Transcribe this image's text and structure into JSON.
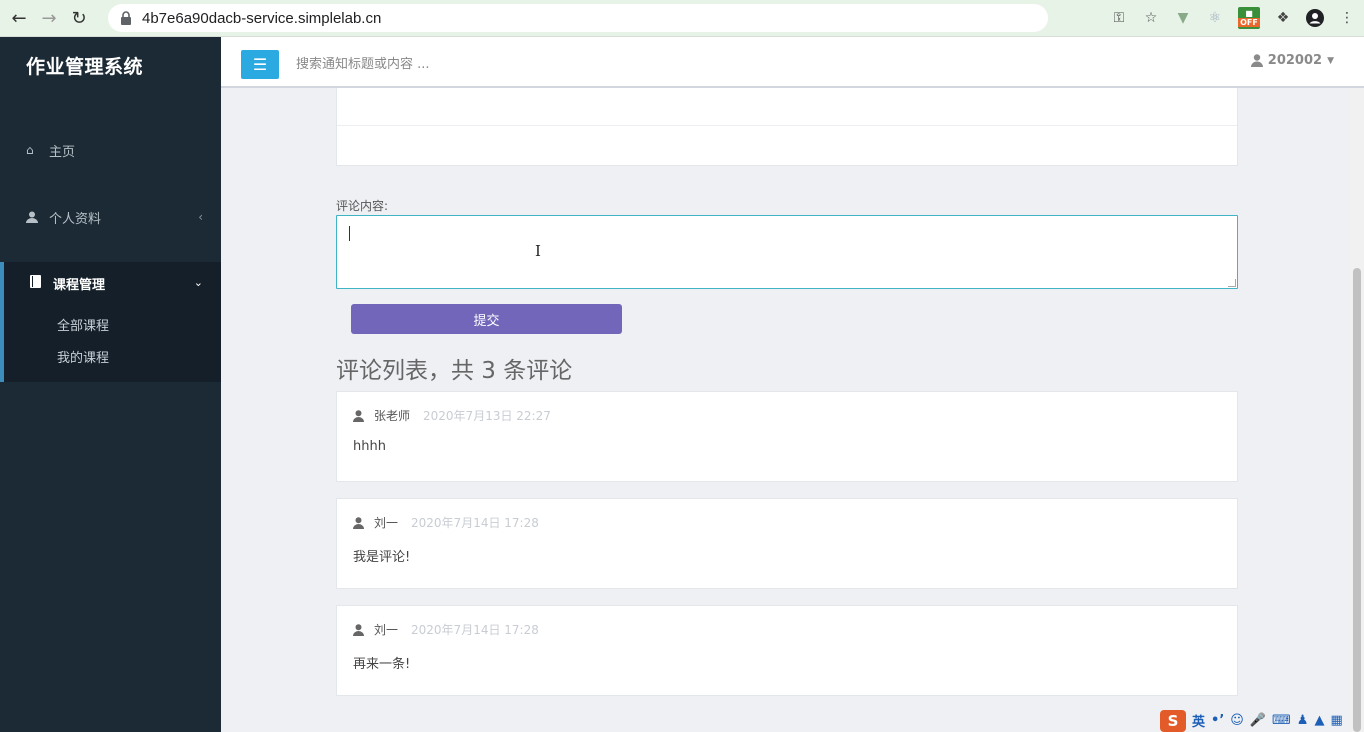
{
  "browser": {
    "url": "4b7e6a90dacb-service.simplelab.cn",
    "ext_off_label": "OFF"
  },
  "sidebar": {
    "brand": "作业管理系统",
    "items": [
      {
        "label": "主页"
      },
      {
        "label": "个人资料"
      },
      {
        "label": "课程管理"
      }
    ],
    "subitems": [
      {
        "label": "全部课程"
      },
      {
        "label": "我的课程"
      }
    ]
  },
  "topbar": {
    "search_placeholder": "搜索通知标题或内容 ...",
    "user": "202002"
  },
  "form": {
    "label": "评论内容:",
    "submit_label": "提交"
  },
  "comments": {
    "title": "评论列表，共 3 条评论",
    "items": [
      {
        "author": "张老师",
        "time": "2020年7月13日 22:27",
        "text": "hhhh"
      },
      {
        "author": "刘一",
        "time": "2020年7月14日 17:28",
        "text": "我是评论!"
      },
      {
        "author": "刘一",
        "time": "2020年7月14日 17:28",
        "text": "再来一条!"
      }
    ]
  },
  "tray": {
    "ime_mode": "英"
  },
  "colors": {
    "sidebar_bg": "#1c2a36",
    "accent_blue": "#2aaae0",
    "submit_purple": "#7266ba",
    "focus_teal": "#3fb4c4"
  }
}
